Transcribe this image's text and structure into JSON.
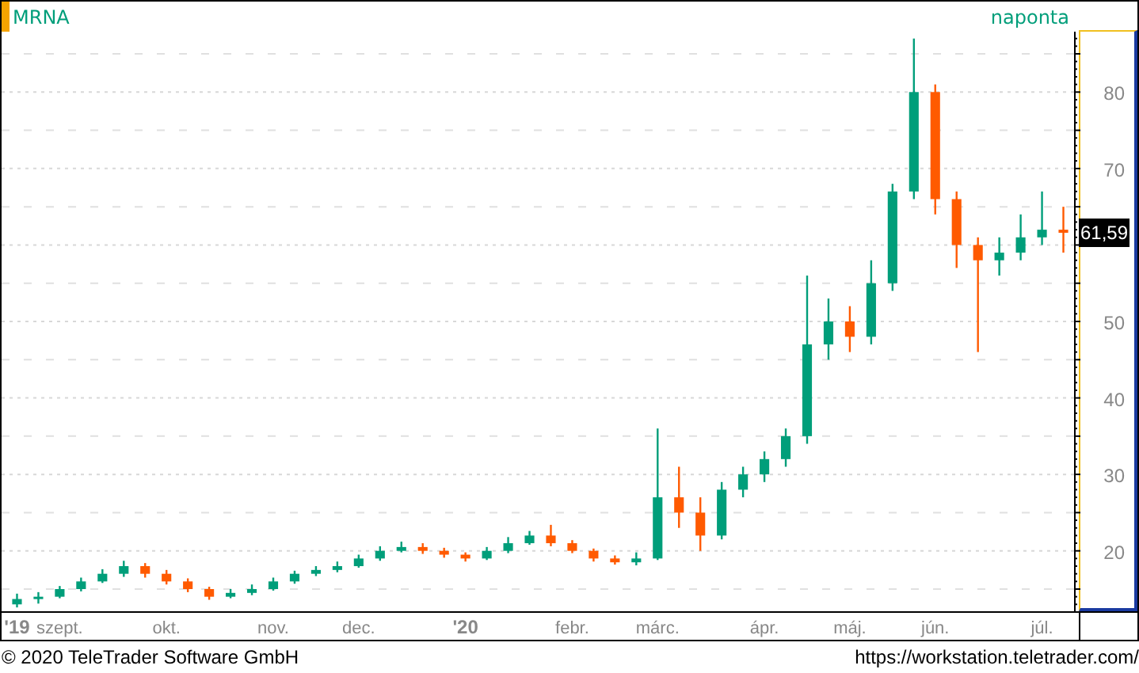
{
  "header": {
    "interval": "naponta"
  },
  "last_price": "61,59",
  "chart": {
    "chart_data": {
      "type": "candlestick",
      "title": "MRNA",
      "categories": [
        "'19",
        null,
        "szept.",
        null,
        null,
        null,
        null,
        "okt.",
        null,
        null,
        null,
        null,
        "nov.",
        null,
        null,
        null,
        "dec.",
        null,
        null,
        null,
        null,
        "'20",
        null,
        null,
        null,
        null,
        "febr.",
        null,
        null,
        null,
        "márc.",
        null,
        null,
        null,
        null,
        "ápr.",
        null,
        null,
        null,
        "máj.",
        null,
        null,
        null,
        "jún.",
        null,
        null,
        null,
        null,
        "júl.",
        null
      ],
      "ohlc": [
        [
          13,
          14.4,
          12.6,
          13.7
        ],
        [
          13.7,
          14.6,
          13.1,
          14
        ],
        [
          14,
          15.4,
          13.8,
          15
        ],
        [
          15,
          16.5,
          14.7,
          16
        ],
        [
          16,
          17.6,
          15.8,
          17
        ],
        [
          17,
          18.7,
          16.6,
          18
        ],
        [
          18,
          18.4,
          16.5,
          17
        ],
        [
          17,
          17.5,
          15.6,
          16
        ],
        [
          16,
          16.4,
          14.6,
          15
        ],
        [
          15,
          15.3,
          13.6,
          14
        ],
        [
          14,
          15,
          13.8,
          14.5
        ],
        [
          14.5,
          15.6,
          14.2,
          15
        ],
        [
          15,
          16.5,
          14.8,
          16
        ],
        [
          16,
          17.4,
          15.7,
          17
        ],
        [
          17,
          18,
          16.7,
          17.5
        ],
        [
          17.5,
          18.6,
          17.2,
          18
        ],
        [
          18,
          19.5,
          17.8,
          19
        ],
        [
          19,
          20.6,
          18.7,
          20
        ],
        [
          20,
          21.2,
          19.8,
          20.5
        ],
        [
          20.5,
          21,
          19.6,
          20
        ],
        [
          20,
          20.4,
          19.1,
          19.5
        ],
        [
          19.5,
          19.8,
          18.6,
          19
        ],
        [
          19,
          20.5,
          18.8,
          20
        ],
        [
          20,
          21.8,
          19.7,
          21
        ],
        [
          21,
          22.6,
          20.8,
          22
        ],
        [
          22,
          23.4,
          20.6,
          21
        ],
        [
          21,
          21.4,
          19.7,
          20
        ],
        [
          20,
          20.3,
          18.6,
          19
        ],
        [
          19,
          19.4,
          18.2,
          18.5
        ],
        [
          18.5,
          19.8,
          18.1,
          19
        ],
        [
          19,
          36,
          18.8,
          27
        ],
        [
          27,
          31,
          23,
          25
        ],
        [
          25,
          27,
          20,
          22
        ],
        [
          22,
          29,
          21.5,
          28
        ],
        [
          28,
          31,
          27,
          30
        ],
        [
          30,
          33,
          29,
          32
        ],
        [
          32,
          36,
          31,
          35
        ],
        [
          35,
          56,
          34,
          47
        ],
        [
          47,
          53,
          45,
          50
        ],
        [
          50,
          52,
          46,
          48
        ],
        [
          48,
          58,
          47,
          55
        ],
        [
          55,
          68,
          54,
          67
        ],
        [
          67,
          87,
          66,
          80
        ],
        [
          80,
          81,
          64,
          66
        ],
        [
          66,
          67,
          57,
          60
        ],
        [
          60,
          61,
          46,
          58
        ],
        [
          58,
          61,
          56,
          59
        ],
        [
          59,
          64,
          58,
          61
        ],
        [
          61,
          67,
          60,
          62
        ],
        [
          62,
          65,
          59,
          61.6
        ]
      ],
      "ylim": [
        12.1,
        87.9
      ],
      "grid": true,
      "yticks": [
        20,
        30,
        40,
        50,
        70,
        80
      ]
    }
  },
  "footer": {
    "copyright": "© 2020 TeleTrader Software GmbH",
    "url": "https://workstation.teletrader.com/"
  }
}
